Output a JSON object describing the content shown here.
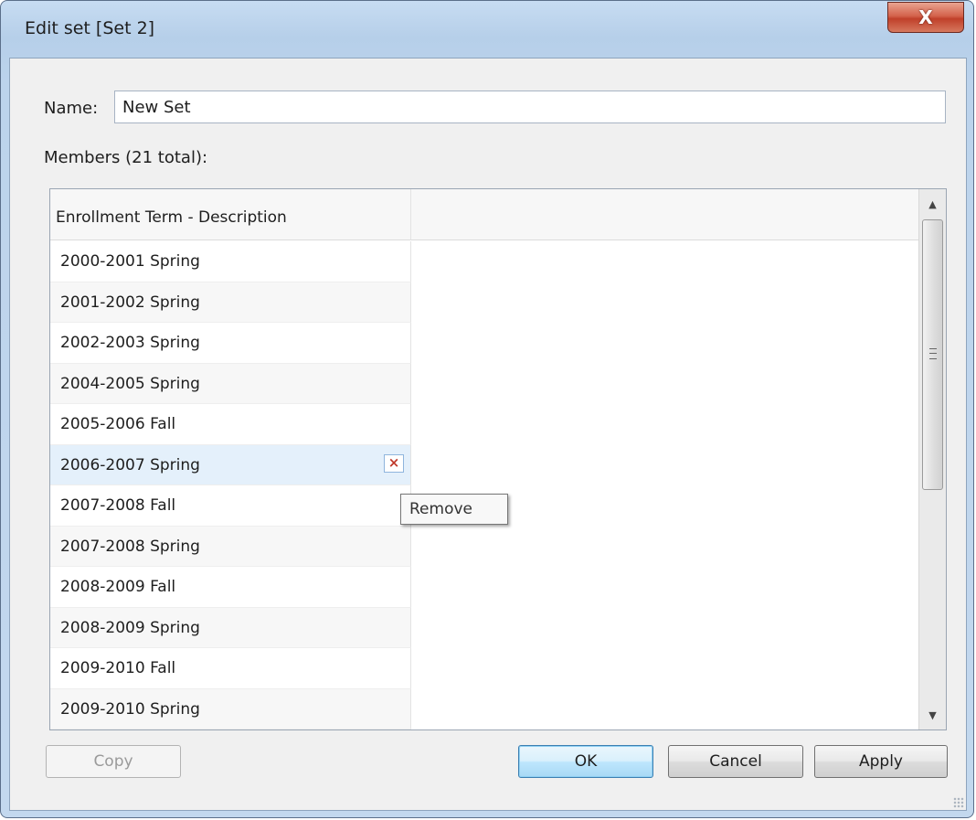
{
  "window": {
    "title": "Edit set [Set 2]",
    "close_glyph": "X"
  },
  "form": {
    "name_label": "Name:",
    "name_value": "New Set",
    "members_label": "Members (21 total):"
  },
  "list": {
    "column_header": "Enrollment Term - Description",
    "rows": [
      "2000-2001 Spring",
      "2001-2002 Spring",
      "2002-2003 Spring",
      "2004-2005 Spring",
      "2005-2006 Fall",
      "2006-2007 Spring",
      "2007-2008 Fall",
      "2007-2008 Spring",
      "2008-2009 Fall",
      "2008-2009 Spring",
      "2009-2010 Fall",
      "2009-2010 Spring"
    ],
    "remove_glyph": "×",
    "tooltip": "Remove"
  },
  "scrollbar": {
    "up_icon": "▲",
    "down_icon": "▼"
  },
  "buttons": {
    "copy": "Copy",
    "ok": "OK",
    "cancel": "Cancel",
    "apply": "Apply"
  },
  "colors": {
    "close_red": "#c0402a",
    "remove_red": "#c0392b",
    "hover_row": "#e4f0fb",
    "default_button": "#3c7fb1"
  }
}
